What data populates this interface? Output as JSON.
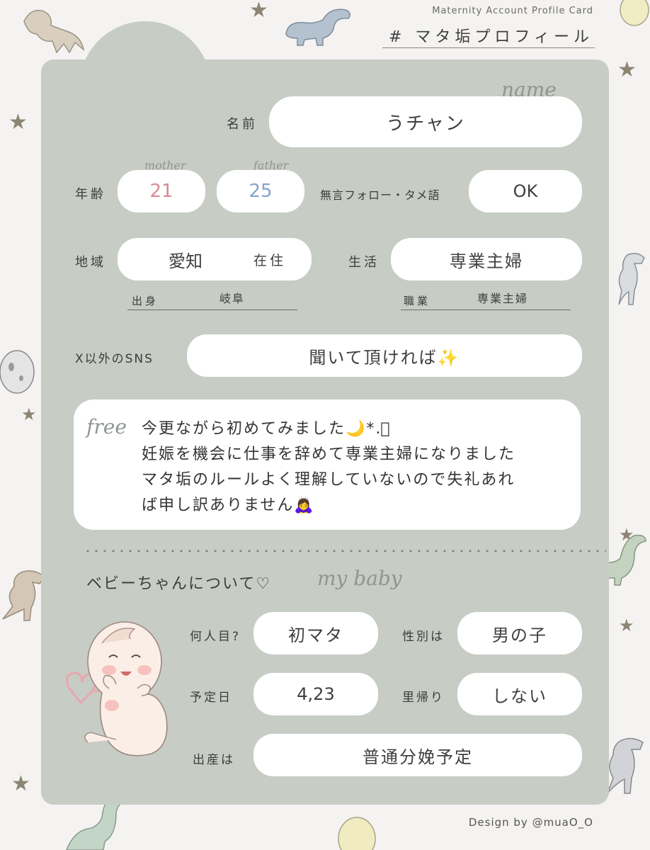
{
  "header": {
    "subtitle": "Maternity Account Profile Card",
    "title": "# マタ垢プロフィール"
  },
  "name": {
    "script": "name",
    "label": "名前",
    "value": "うチャン"
  },
  "age": {
    "label": "年齢",
    "mother_label": "mother",
    "mother_value": "21",
    "father_label": "father",
    "father_value": "25",
    "mother_color": "#d98a97",
    "father_color": "#86a3c9"
  },
  "follow": {
    "label": "無言フォロー・タメ語",
    "value": "OK"
  },
  "region": {
    "label": "地域",
    "value": "愛知",
    "suffix": "在住",
    "origin_label": "出身",
    "origin_value": "岐阜"
  },
  "life": {
    "label": "生活",
    "value": "専業主婦",
    "job_label": "職業",
    "job_value": "専業主婦"
  },
  "sns": {
    "label": "X以外のSNS",
    "value": "聞いて頂ければ✨"
  },
  "free": {
    "script": "free",
    "lines": [
      "今更ながら初めてみました🌙*.ﾟ",
      "妊娠を機会に仕事を辞めて専業主婦になりました",
      "マタ垢のルールよく理解していないので失礼あれ",
      "ば申し訳ありません🙇‍♀️"
    ]
  },
  "baby": {
    "heading": "ベビーちゃんについて♡",
    "script": "my baby",
    "nth_label": "何人目?",
    "nth_value": "初マタ",
    "gender_label": "性別は",
    "gender_value": "男の子",
    "due_label": "予定日",
    "due_value": "4,23",
    "return_label": "里帰り",
    "return_value": "しない",
    "birth_label": "出産は",
    "birth_value": "普通分娩予定"
  },
  "footer": {
    "credit": "Design by @muaO_O"
  },
  "icons": [
    "dinosaur-icon",
    "star-icon",
    "dino-egg-icon",
    "baby-illustration",
    "heart-icon"
  ],
  "colors": {
    "card": "#c7ccc4",
    "background": "#f4f3f1",
    "pill": "#ffffff"
  }
}
